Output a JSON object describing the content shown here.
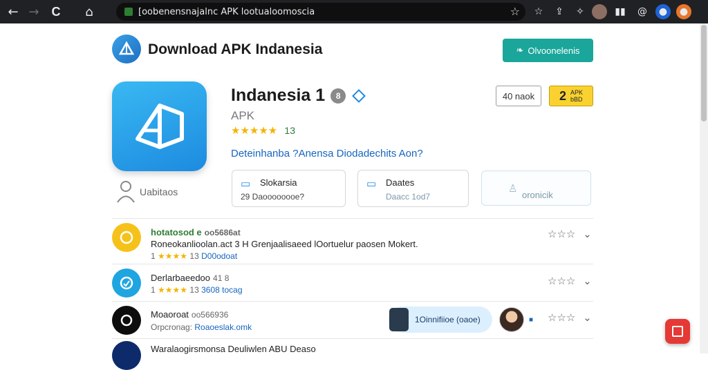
{
  "browser": {
    "url": "[oobenensnajalnc APK lootualoomoscia",
    "back": "←",
    "forward": "→",
    "reload": "C",
    "home": "⌂",
    "bookmark": "☆"
  },
  "header": {
    "site_title": "Download APK Indanesia",
    "button_label": "Olvoonelenis"
  },
  "app": {
    "name": "Indanesia 1",
    "badge": "8",
    "subtitle": "APK",
    "stars": "★★★★★",
    "rating_count": "13",
    "description_link": "Deteinhanba ?Anensa Diodadechits Aon?",
    "developer_label": "Uabitaos",
    "stat_gray": "40 naok",
    "stat_yellow_big": "2",
    "stat_yellow_small_1": "APK",
    "stat_yellow_small_2": "bBD"
  },
  "cards": [
    {
      "title": "Slokarsia",
      "subtitle": "29 Daoooooooe?"
    },
    {
      "title": "Daates",
      "subtitle": "Daacc 1od7"
    },
    {
      "title": "oronicik"
    }
  ],
  "list": [
    {
      "title": "hotatosod e",
      "title_sub": "oo5686at",
      "desc": "Roneokanlioolan.act 3 H Grenjaalisaeed lOortuelur paosen Mokert.",
      "meta_prefix": "1",
      "stars": "★★★★",
      "meta_num": "13",
      "meta_link": "D00odoat",
      "icon_color": "#f6c21a"
    },
    {
      "title": "Derlarbaeedoo",
      "title_sub": "41 8",
      "meta_prefix": "1",
      "stars": "★★★★",
      "meta_num": "13",
      "meta_link": "3608 tocag",
      "icon_color": "#1fa5e0"
    },
    {
      "title": "Moaoroat",
      "title_sub": "oo566936",
      "meta_prefix": "Orpcronag:",
      "meta_link": "Roaoeslak.omk",
      "icon_color": "#0d0d0d"
    }
  ],
  "chat": {
    "label": "1Oinnifiioe (oaoe)",
    "flag": "■"
  },
  "last_row": "Waralaogirsmonsa  Deuliwlen  ABU Deaso"
}
